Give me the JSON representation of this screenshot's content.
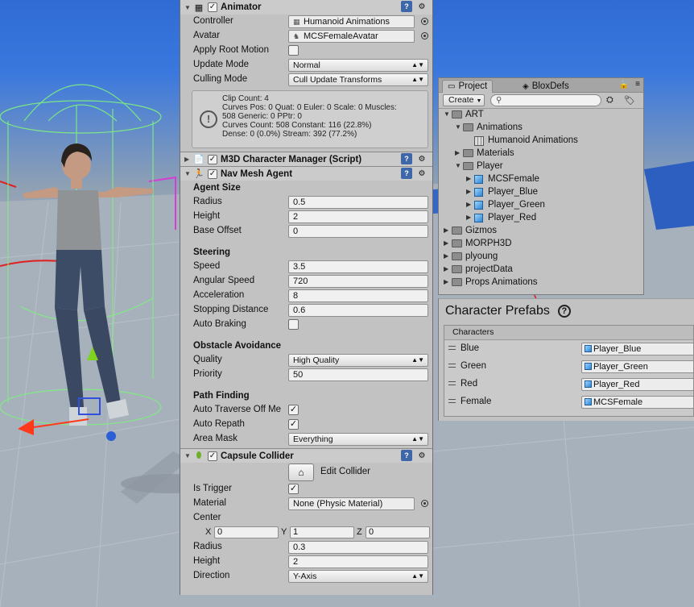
{
  "animator": {
    "title": "Animator",
    "controller_label": "Controller",
    "controller_value": "Humanoid Animations",
    "avatar_label": "Avatar",
    "avatar_value": "MCSFemaleAvatar",
    "apply_root_motion_label": "Apply Root Motion",
    "apply_root_motion": false,
    "update_mode_label": "Update Mode",
    "update_mode_value": "Normal",
    "culling_mode_label": "Culling Mode",
    "culling_mode_value": "Cull Update Transforms",
    "info_lines": [
      "Clip Count: 4",
      "Curves Pos: 0 Quat: 0 Euler: 0 Scale: 0 Muscles:",
      "508 Generic: 0 PPtr: 0",
      "Curves Count: 508 Constant: 116 (22.8%)",
      "Dense: 0 (0.0%) Stream: 392 (77.2%)"
    ]
  },
  "m3d": {
    "title": "M3D Character Manager (Script)"
  },
  "navmesh": {
    "title": "Nav Mesh Agent",
    "agent_size_heading": "Agent Size",
    "radius_label": "Radius",
    "radius_value": "0.5",
    "height_label": "Height",
    "height_value": "2",
    "base_offset_label": "Base Offset",
    "base_offset_value": "0",
    "steering_heading": "Steering",
    "speed_label": "Speed",
    "speed_value": "3.5",
    "angular_speed_label": "Angular Speed",
    "angular_speed_value": "720",
    "acceleration_label": "Acceleration",
    "acceleration_value": "8",
    "stopping_distance_label": "Stopping Distance",
    "stopping_distance_value": "0.6",
    "auto_braking_label": "Auto Braking",
    "obstacle_heading": "Obstacle Avoidance",
    "quality_label": "Quality",
    "quality_value": "High Quality",
    "priority_label": "Priority",
    "priority_value": "50",
    "pathfinding_heading": "Path Finding",
    "auto_traverse_label": "Auto Traverse Off Me",
    "auto_repath_label": "Auto Repath",
    "area_mask_label": "Area Mask",
    "area_mask_value": "Everything"
  },
  "capsule": {
    "title": "Capsule Collider",
    "edit_collider_label": "Edit Collider",
    "is_trigger_label": "Is Trigger",
    "material_label": "Material",
    "material_value": "None (Physic Material)",
    "center_label": "Center",
    "x_label": "X",
    "x_value": "0",
    "y_label": "Y",
    "y_value": "1",
    "z_label": "Z",
    "z_value": "0",
    "radius_label": "Radius",
    "radius_value": "0.3",
    "height_label": "Height",
    "height_value": "2",
    "direction_label": "Direction",
    "direction_value": "Y-Axis"
  },
  "project": {
    "tab_project": "Project",
    "tab_bloxdefs": "BloxDefs",
    "create_label": "Create",
    "tree": [
      {
        "label": "ART",
        "depth": 0,
        "icon": "folder-icon",
        "expanded": true
      },
      {
        "label": "Animations",
        "depth": 1,
        "icon": "folder-icon",
        "expanded": true
      },
      {
        "label": "Humanoid Animations",
        "depth": 2,
        "icon": "animator-controller-icon",
        "leaf": true
      },
      {
        "label": "Materials",
        "depth": 1,
        "icon": "folder-icon",
        "expanded": false
      },
      {
        "label": "Player",
        "depth": 1,
        "icon": "folder-icon",
        "expanded": true
      },
      {
        "label": "MCSFemale",
        "depth": 2,
        "icon": "prefab-icon",
        "expanded": false
      },
      {
        "label": "Player_Blue",
        "depth": 2,
        "icon": "prefab-icon",
        "expanded": false
      },
      {
        "label": "Player_Green",
        "depth": 2,
        "icon": "prefab-icon",
        "expanded": false
      },
      {
        "label": "Player_Red",
        "depth": 2,
        "icon": "prefab-icon",
        "expanded": false
      },
      {
        "label": "Gizmos",
        "depth": 0,
        "icon": "folder-icon",
        "expanded": false
      },
      {
        "label": "MORPH3D",
        "depth": 0,
        "icon": "folder-icon",
        "expanded": false
      },
      {
        "label": "plyoung",
        "depth": 0,
        "icon": "folder-icon",
        "expanded": false
      },
      {
        "label": "projectData",
        "depth": 0,
        "icon": "folder-icon",
        "expanded": false
      },
      {
        "label": "Props Animations",
        "depth": 0,
        "icon": "folder-icon",
        "expanded": false
      }
    ]
  },
  "prefabs": {
    "title": "Character  Prefabs",
    "help": "?",
    "header": "Characters",
    "rows": [
      {
        "label": "Blue",
        "value": "Player_Blue"
      },
      {
        "label": "Green",
        "value": "Player_Green"
      },
      {
        "label": "Red",
        "value": "Player_Red"
      },
      {
        "label": "Female",
        "value": "MCSFemale"
      }
    ]
  },
  "colors": {
    "panel_bg": "#c2c2c2",
    "sky": "#3a78de",
    "arrow": "#e02020",
    "gizmo_green": "#7ff07f"
  }
}
